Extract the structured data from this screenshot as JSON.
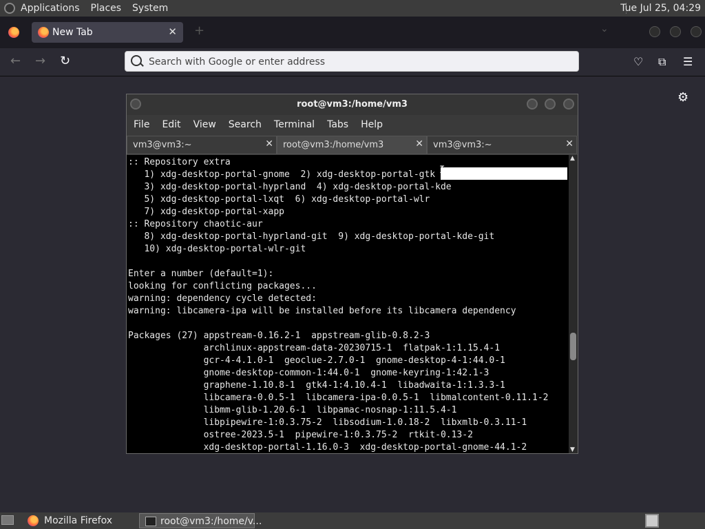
{
  "top_panel": {
    "menus": [
      "Applications",
      "Places",
      "System"
    ],
    "clock": "Tue Jul 25, 04:29"
  },
  "firefox": {
    "tab_title": "New Tab",
    "url_placeholder": "Search with Google or enter address"
  },
  "terminal": {
    "window_title": "root@vm3:/home/vm3",
    "menus": [
      "File",
      "Edit",
      "View",
      "Search",
      "Terminal",
      "Tabs",
      "Help"
    ],
    "tabs": [
      {
        "label": "vm3@vm3:~"
      },
      {
        "label": "root@vm3:/home/vm3"
      },
      {
        "label": "vm3@vm3:~"
      }
    ],
    "lines": [
      ":: Repository extra",
      "   1) xdg-desktop-portal-gnome  2) xdg-desktop-portal-gtk",
      "   3) xdg-desktop-portal-hyprland  4) xdg-desktop-portal-kde",
      "   5) xdg-desktop-portal-lxqt  6) xdg-desktop-portal-wlr",
      "   7) xdg-desktop-portal-xapp",
      ":: Repository chaotic-aur",
      "   8) xdg-desktop-portal-hyprland-git  9) xdg-desktop-portal-kde-git",
      "   10) xdg-desktop-portal-wlr-git",
      "",
      "Enter a number (default=1):",
      "looking for conflicting packages...",
      "warning: dependency cycle detected:",
      "warning: libcamera-ipa will be installed before its libcamera dependency",
      "",
      "Packages (27) appstream-0.16.2-1  appstream-glib-0.8.2-3",
      "              archlinux-appstream-data-20230715-1  flatpak-1:1.15.4-1",
      "              gcr-4-4.1.0-1  geoclue-2.7.0-1  gnome-desktop-4-1:44.0-1",
      "              gnome-desktop-common-1:44.0-1  gnome-keyring-1:42.1-3",
      "              graphene-1.10.8-1  gtk4-1:4.10.4-1  libadwaita-1:1.3.3-1",
      "              libcamera-0.0.5-1  libcamera-ipa-0.0.5-1  libmalcontent-0.11.1-2",
      "              libmm-glib-1.20.6-1  libpamac-nosnap-1:11.5.4-1",
      "              libpipewire-1:0.3.75-2  libsodium-1.0.18-2  libxmlb-0.3.11-1",
      "              ostree-2023.5-1  pipewire-1:0.3.75-2  rtkit-0.13-2",
      "              xdg-desktop-portal-1.16.0-3  xdg-desktop-portal-gnome-44.1-2"
    ]
  },
  "taskbar": {
    "items": [
      {
        "label": "Mozilla Firefox"
      },
      {
        "label": "root@vm3:/home/v..."
      }
    ]
  }
}
